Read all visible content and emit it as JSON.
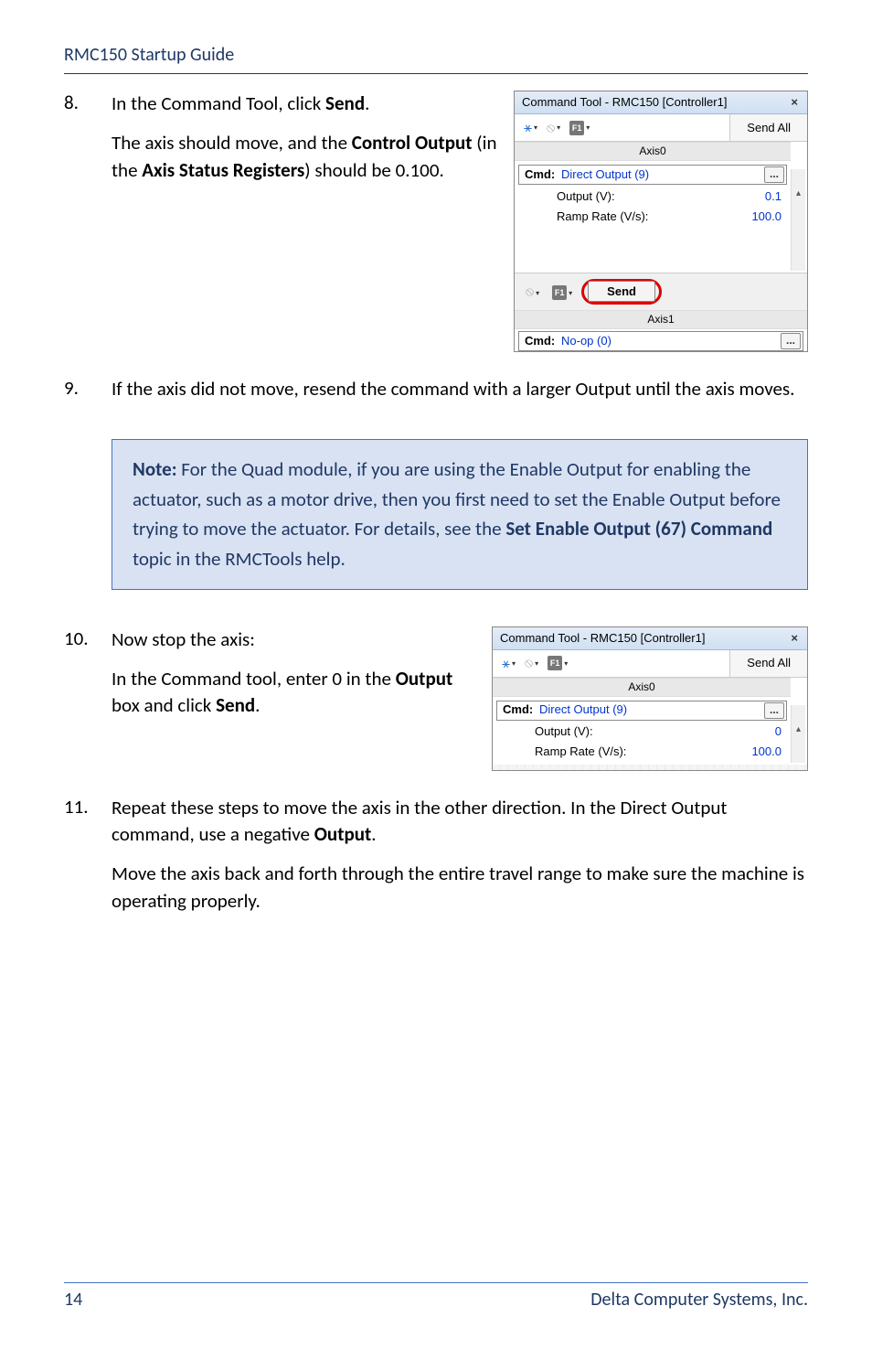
{
  "header": {
    "title": "RMC150 Startup Guide"
  },
  "steps": {
    "s8": {
      "num": "8.",
      "line1_a": "In the Command Tool, click ",
      "line1_b": "Send",
      "line1_c": ".",
      "line2_a": "The axis should move, and the ",
      "line2_b": "Control Output",
      "line2_c": " (in the ",
      "line2_d": "Axis Status Registers",
      "line2_e": ") should be 0.100."
    },
    "s9": {
      "num": "9.",
      "text": "If the axis did not move, resend the command with a larger Output until the axis moves."
    },
    "note": {
      "label": "Note:",
      "body_a": " For the Quad module, if you are using the Enable Output for enabling the actuator, such as a motor drive, then you first need to set the Enable Output before trying to move the actuator. For details, see the ",
      "body_b": "Set Enable Output (67) Command",
      "body_c": " topic in the RMCTools help."
    },
    "s10": {
      "num": "10.",
      "line1": "Now stop the axis:",
      "line2_a": "In the Command tool, enter 0 in the ",
      "line2_b": "Output",
      "line2_c": " box and click ",
      "line2_d": "Send",
      "line2_e": "."
    },
    "s11": {
      "num": "11.",
      "line1_a": "Repeat these steps to move the axis in the other direction. In the Direct Output command, use a negative ",
      "line1_b": "Output",
      "line1_c": ".",
      "line2": "Move the axis back and forth through the entire travel range to make sure the machine is operating properly."
    }
  },
  "panel1": {
    "title": "Command Tool - RMC150 [Controller1]",
    "close": "×",
    "send_all": "Send All",
    "axis0": "Axis0",
    "cmd_prefix": "Cmd:",
    "cmd_name": "Direct Output (9)",
    "ellipsis": "...",
    "output_lbl": "Output (V):",
    "output_val": "0.1",
    "ramp_lbl": "Ramp Rate (V/s):",
    "ramp_val": "100.0",
    "send": "Send",
    "axis1": "Axis1",
    "cmd2_prefix": "Cmd:",
    "cmd2_name": "No-op (0)",
    "ellipsis2": "..."
  },
  "panel2": {
    "title": "Command Tool - RMC150 [Controller1]",
    "close": "×",
    "send_all": "Send All",
    "axis0": "Axis0",
    "cmd_prefix": "Cmd:",
    "cmd_name": "Direct Output (9)",
    "ellipsis": "...",
    "output_lbl": "Output (V):",
    "output_val": "0",
    "ramp_lbl": "Ramp Rate (V/s):",
    "ramp_val": "100.0"
  },
  "footer": {
    "page": "14",
    "company": "Delta Computer Systems, Inc."
  }
}
